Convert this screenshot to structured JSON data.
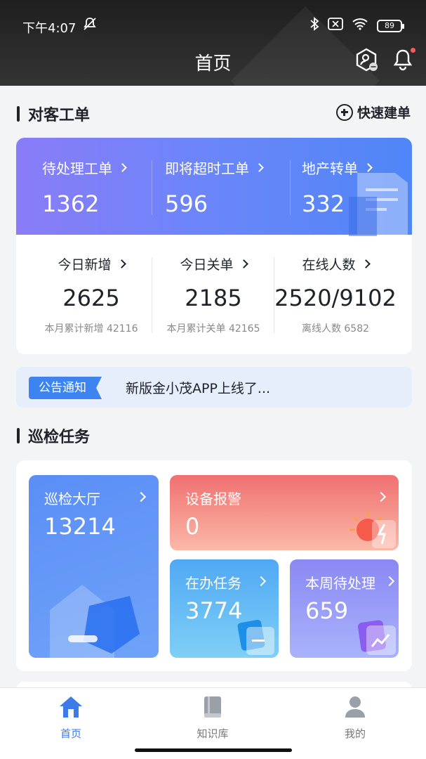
{
  "status_bar": {
    "time": "下午4:07",
    "battery": "89"
  },
  "header": {
    "title": "首页"
  },
  "colors": {
    "accent": "#3d7be8",
    "ticket_gradient_start": "#8a7cf8",
    "ticket_gradient_end": "#4f86f7",
    "alarm_tile": "#f27b7b",
    "progress_tile": "#52b4f0",
    "weekly_tile": "#8b8af4",
    "hall_tile": "#5a93f5"
  },
  "ticket_section": {
    "title": "对客工单",
    "quick_create_label": "快速建单",
    "top_stats": [
      {
        "label": "待处理工单",
        "value": "1362"
      },
      {
        "label": "即将超时工单",
        "value": "596"
      },
      {
        "label": "地产转单",
        "value": "332"
      }
    ],
    "bottom_stats": [
      {
        "label": "今日新增",
        "value": "2625",
        "sub": "本月累计新增 42116"
      },
      {
        "label": "今日关单",
        "value": "2185",
        "sub": "本月累计关单 42165"
      },
      {
        "label": "在线人数",
        "value": "2520/9102",
        "sub": "离线人数 6582"
      }
    ]
  },
  "notice": {
    "badge": "公告通知",
    "text": "新版金小茂APP上线了..."
  },
  "inspection_section": {
    "title": "巡检任务",
    "tiles": [
      {
        "label": "巡检大厅",
        "value": "13214"
      },
      {
        "label": "设备报警",
        "value": "0"
      },
      {
        "label": "在办任务",
        "value": "3774"
      },
      {
        "label": "本周待处理",
        "value": "659"
      }
    ]
  },
  "tabbar": {
    "items": [
      {
        "label": "首页",
        "icon": "home-icon",
        "active": true
      },
      {
        "label": "知识库",
        "icon": "book-icon",
        "active": false
      },
      {
        "label": "我的",
        "icon": "user-icon",
        "active": false
      }
    ]
  }
}
